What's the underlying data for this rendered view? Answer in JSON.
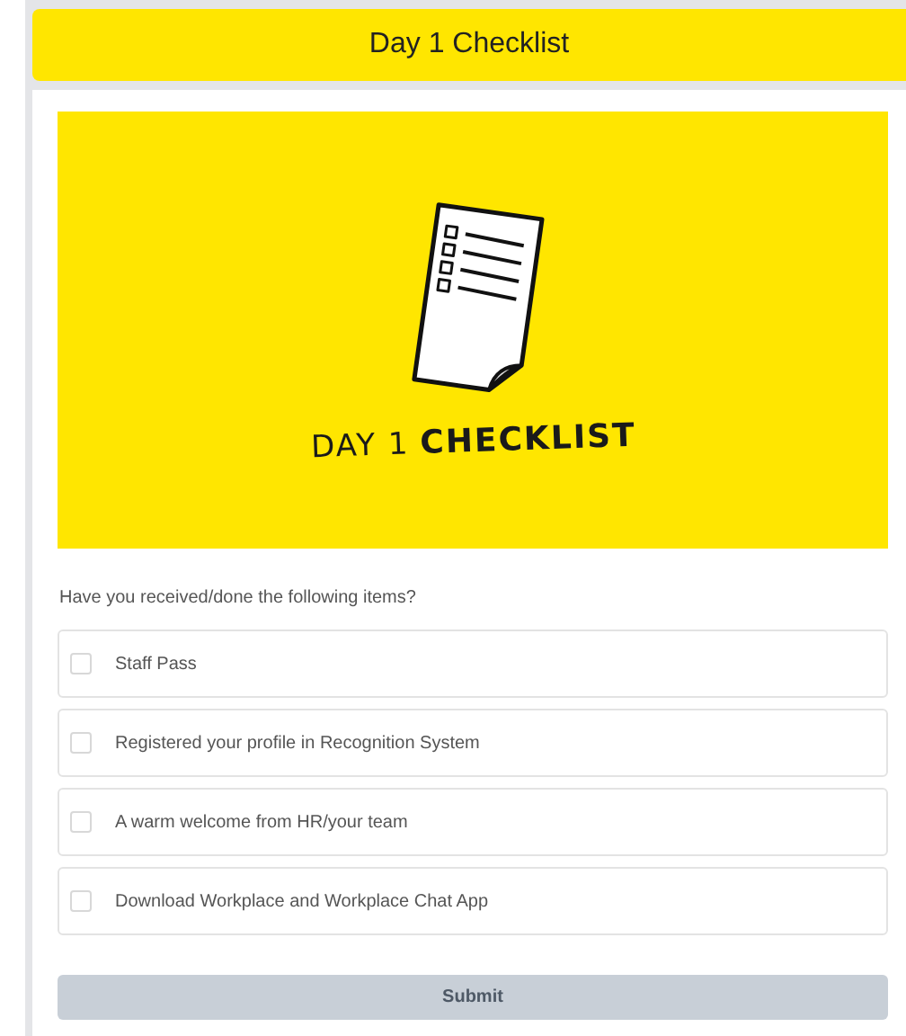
{
  "header": {
    "title": "Day 1 Checklist"
  },
  "banner": {
    "caption_plain": "DAY 1",
    "caption_bold": "CHECKLIST"
  },
  "question": "Have you received/done the following items?",
  "items": [
    {
      "label": "Staff Pass",
      "checked": false
    },
    {
      "label": "Registered your profile in Recognition System",
      "checked": false
    },
    {
      "label": "A warm welcome from HR/your team",
      "checked": false
    },
    {
      "label": "Download Workplace and Workplace Chat App",
      "checked": false
    }
  ],
  "submit": {
    "label": "Submit",
    "disabled": true
  }
}
